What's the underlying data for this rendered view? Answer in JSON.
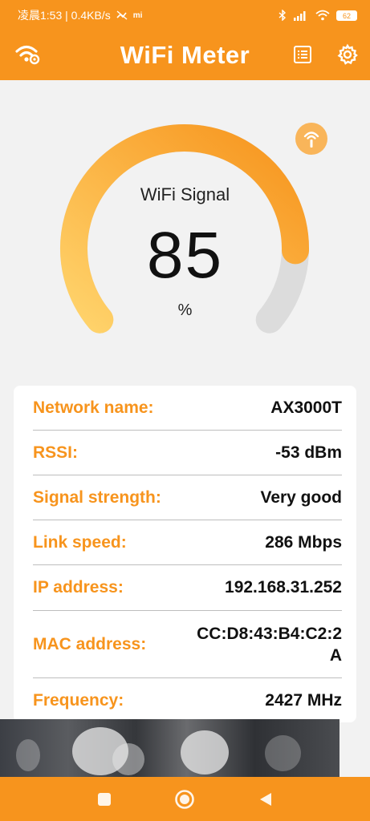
{
  "status_bar": {
    "left_text": "凌晨1:53 | 0.4KB/s",
    "battery": "62"
  },
  "app_bar": {
    "title": "WiFi Meter"
  },
  "gauge": {
    "label": "WiFi Signal",
    "value": "85",
    "unit": "%",
    "fill_fraction": 0.85,
    "colors": {
      "start": "#ffd36b",
      "end": "#f7941d",
      "track": "#dcdcdc"
    }
  },
  "info": {
    "rows": [
      {
        "key": "Network name:",
        "value": "AX3000T"
      },
      {
        "key": "RSSI:",
        "value": "-53 dBm"
      },
      {
        "key": "Signal strength:",
        "value": "Very good"
      },
      {
        "key": "Link speed:",
        "value": "286 Mbps"
      },
      {
        "key": "IP address:",
        "value": "192.168.31.252"
      },
      {
        "key": "MAC address:",
        "value": "CC:D8:43:B4:C2:2A"
      },
      {
        "key": "Frequency:",
        "value": "2427 MHz"
      }
    ]
  },
  "colors": {
    "accent": "#f7941d",
    "background": "#f2f2f2"
  },
  "icons": {
    "app_bar_left": "wifi-settings-icon",
    "app_bar_list": "list-icon",
    "app_bar_settings": "gear-icon",
    "signal_button": "wifi-signal-icon",
    "nav": [
      "square-icon",
      "circle-icon",
      "triangle-back-icon"
    ]
  }
}
